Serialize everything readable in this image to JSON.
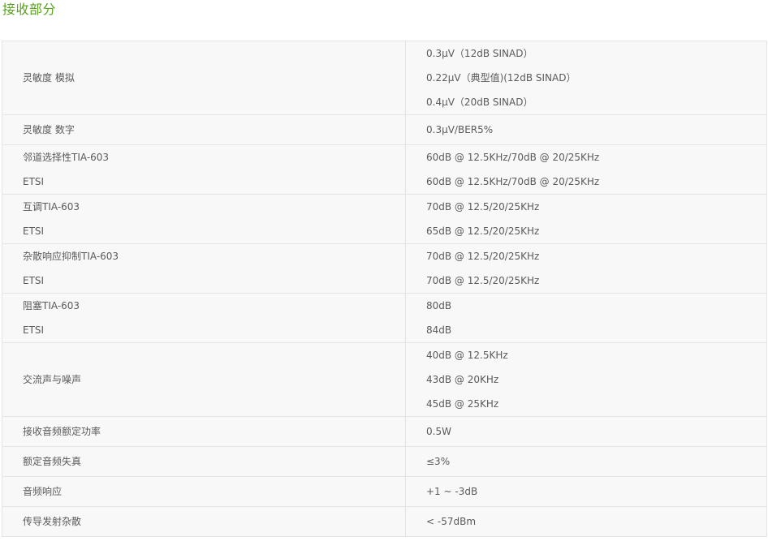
{
  "section": {
    "title": "接收部分"
  },
  "specs": [
    {
      "label": [
        "灵敏度 模拟"
      ],
      "values": [
        "0.3μV（12dB SINAD）",
        "0.22μV（典型值)(12dB SINAD）",
        "0.4μV（20dB SINAD）"
      ]
    },
    {
      "label": [
        "灵敏度 数字"
      ],
      "values": [
        "0.3μV/BER5%"
      ]
    },
    {
      "label": [
        "邻道选择性TIA-603",
        "ETSI"
      ],
      "values": [
        "60dB @ 12.5KHz/70dB @ 20/25KHz",
        "60dB @ 12.5KHz/70dB @ 20/25KHz"
      ]
    },
    {
      "label": [
        "互调TIA-603",
        "ETSI"
      ],
      "values": [
        "70dB @ 12.5/20/25KHz",
        "65dB @ 12.5/20/25KHz"
      ]
    },
    {
      "label": [
        "杂散响应抑制TIA-603",
        "ETSI"
      ],
      "values": [
        "70dB @ 12.5/20/25KHz",
        "70dB @ 12.5/20/25KHz"
      ]
    },
    {
      "label": [
        "阻塞TIA-603",
        "ETSI"
      ],
      "values": [
        "80dB",
        "84dB"
      ]
    },
    {
      "label": [
        "交流声与噪声"
      ],
      "values": [
        "40dB @ 12.5KHz",
        "43dB @ 20KHz",
        "45dB @ 25KHz"
      ]
    },
    {
      "label": [
        "接收音频额定功率"
      ],
      "values": [
        "0.5W"
      ]
    },
    {
      "label": [
        "额定音频失真"
      ],
      "values": [
        "≤3%"
      ]
    },
    {
      "label": [
        "音频响应"
      ],
      "values": [
        "+1 ~ -3dB"
      ]
    },
    {
      "label": [
        "传导发射杂散"
      ],
      "values": [
        "< -57dBm"
      ]
    }
  ]
}
